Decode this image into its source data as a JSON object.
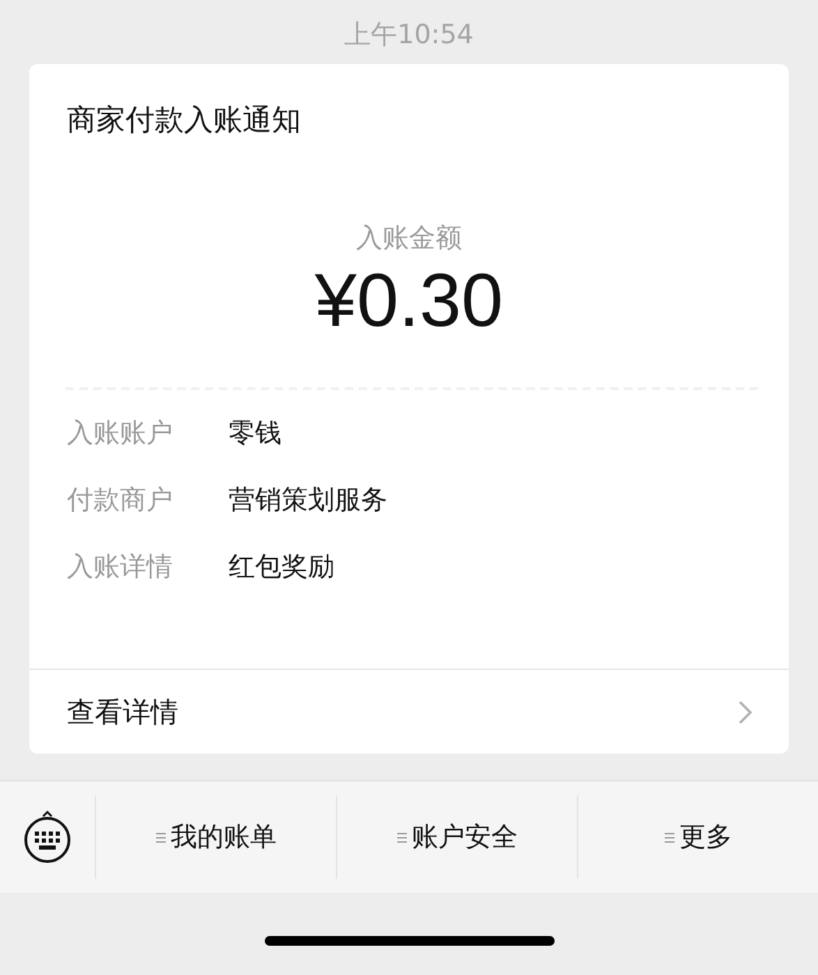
{
  "time": "上午10:54",
  "card": {
    "title": "商家付款入账通知",
    "amount_label": "入账金额",
    "amount": "¥0.30",
    "rows": [
      {
        "label": "入账账户",
        "value": "零钱"
      },
      {
        "label": "付款商户",
        "value": "营销策划服务"
      },
      {
        "label": "入账详情",
        "value": "红包奖励"
      }
    ],
    "details_link": "查看详情"
  },
  "menu": [
    {
      "label": "我的账单"
    },
    {
      "label": "账户安全"
    },
    {
      "label": "更多"
    }
  ]
}
